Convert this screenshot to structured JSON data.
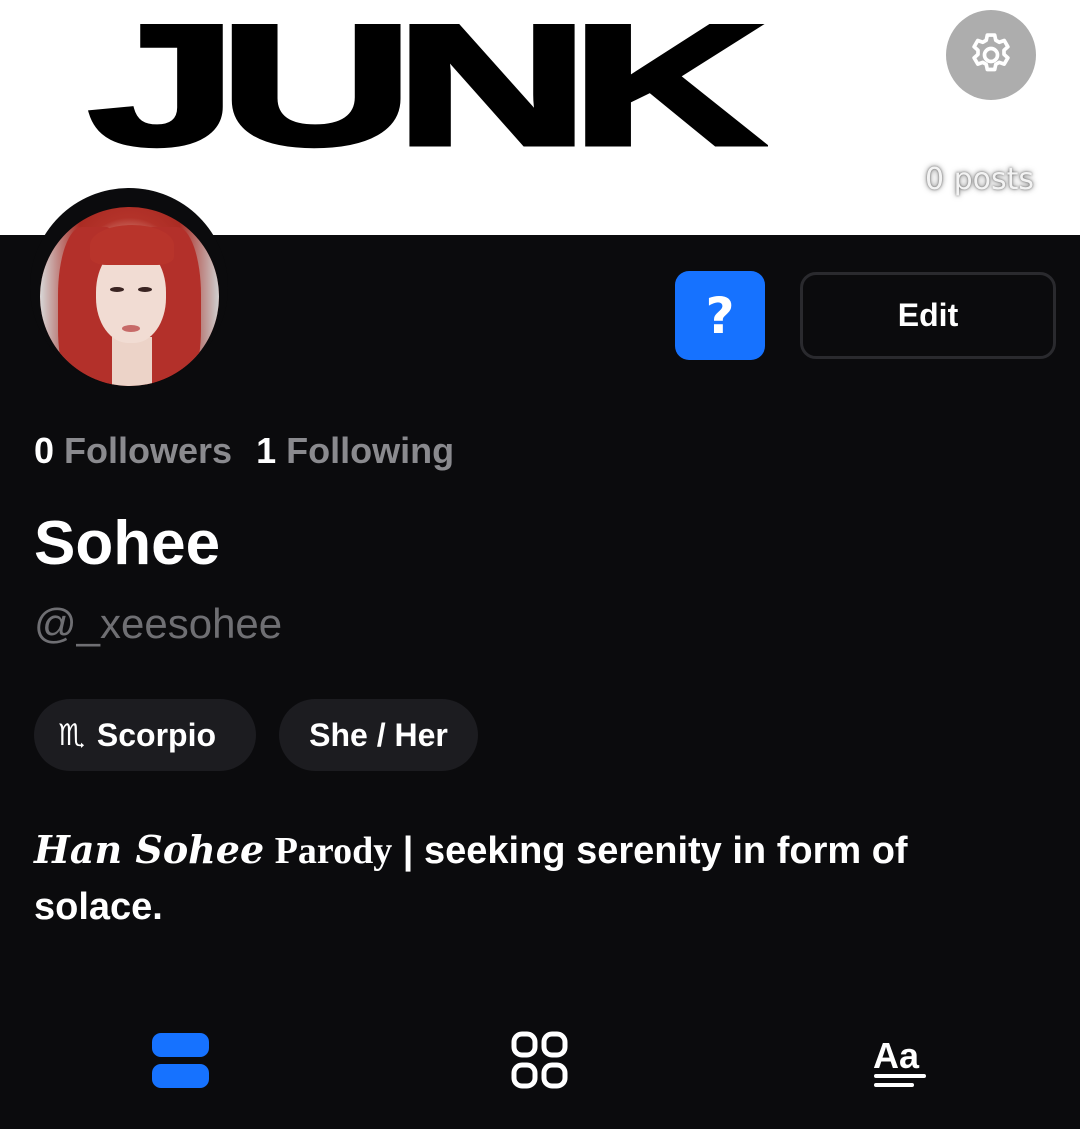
{
  "banner": {
    "word": "JUNK",
    "posts_count": "0 posts"
  },
  "icons": {
    "settings": "gear-icon",
    "help": "question-mark",
    "posts_tab": "stacked-rows-icon",
    "grid_tab": "grid-icon",
    "text_tab": "text-format-icon"
  },
  "actions": {
    "help_label": "?",
    "edit_label": "Edit"
  },
  "stats": {
    "followers_count": "0",
    "followers_label": "Followers",
    "following_count": "1",
    "following_label": "Following"
  },
  "profile": {
    "display_name": "Sohee",
    "handle": "@_xeesohee",
    "zodiac_symbol": "♏",
    "zodiac": "Scorpio",
    "pronouns": "She / Her",
    "bio_fancy": "Han Sohee",
    "bio_serif": "Parody",
    "bio_rest": " | seeking serenity in form of solace."
  },
  "colors": {
    "accent": "#1672ff",
    "background": "#0b0b0d",
    "chip": "#1c1c20",
    "muted": "#8a8a8e"
  }
}
